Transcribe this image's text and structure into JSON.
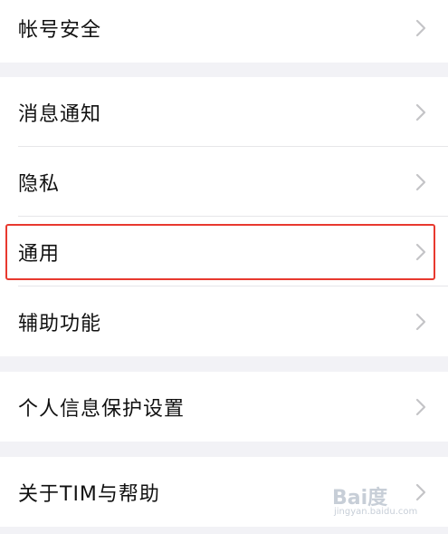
{
  "groups": [
    {
      "items": [
        {
          "label": "帐号安全"
        }
      ]
    },
    {
      "items": [
        {
          "label": "消息通知"
        },
        {
          "label": "隐私"
        },
        {
          "label": "通用"
        },
        {
          "label": "辅助功能"
        }
      ]
    },
    {
      "items": [
        {
          "label": "个人信息保护设置"
        }
      ]
    },
    {
      "items": [
        {
          "label": "关于TIM与帮助"
        }
      ]
    }
  ],
  "highlight": {
    "target": "通用",
    "color": "#e8392f"
  },
  "icons": {
    "chevron": "chevron-right-icon"
  },
  "colors": {
    "background": "#f2f2f6",
    "row": "#ffffff",
    "chevron": "#c4c4c7"
  },
  "watermark": {
    "text": "Bai度",
    "sub": "jingyan.baidu.com"
  }
}
